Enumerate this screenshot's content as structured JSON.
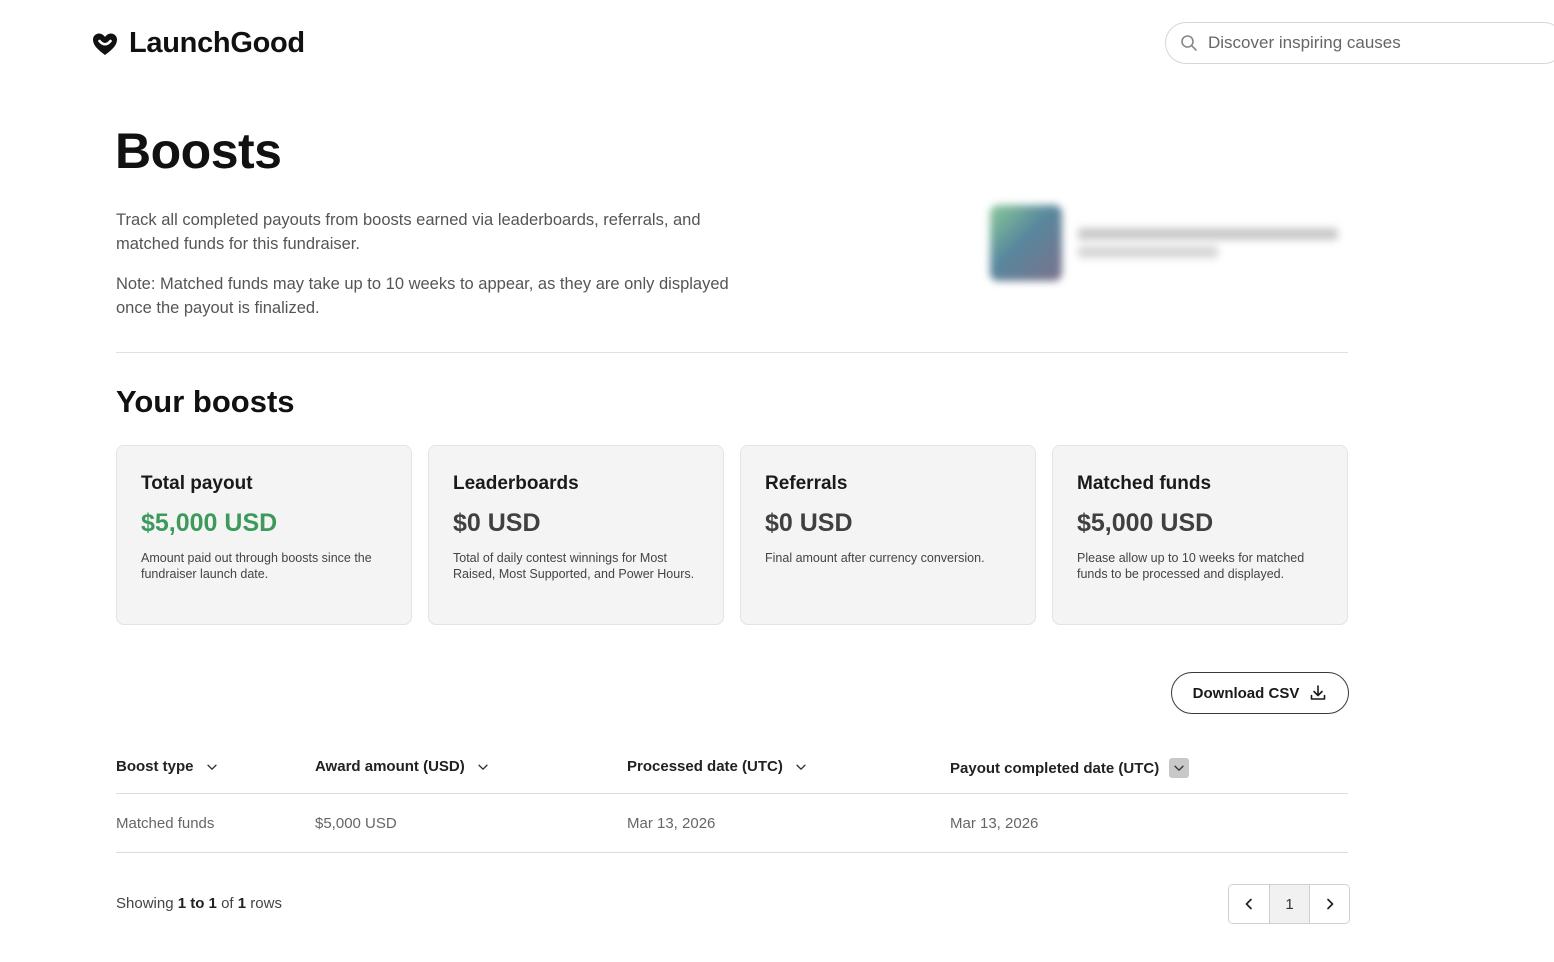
{
  "header": {
    "brand": "LaunchGood",
    "search_placeholder": "Discover inspiring causes"
  },
  "page": {
    "title": "Boosts",
    "intro": "Track all completed payouts from boosts earned via leaderboards, referrals, and matched funds for this fundraiser.",
    "note": "Note: Matched funds may take up to 10 weeks to appear, as they are only displayed once the payout is finalized."
  },
  "boosts": {
    "section_title": "Your boosts",
    "cards": [
      {
        "title": "Total payout",
        "value": "$5,000 USD",
        "desc": "Amount paid out through boosts since the fundraiser launch date."
      },
      {
        "title": "Leaderboards",
        "value": "$0 USD",
        "desc": "Total of daily contest winnings for Most Raised, Most Supported, and Power Hours."
      },
      {
        "title": "Referrals",
        "value": "$0 USD",
        "desc": "Final amount after currency conversion."
      },
      {
        "title": "Matched funds",
        "value": "$5,000 USD",
        "desc": "Please allow up to 10 weeks for matched funds to be processed and displayed."
      }
    ],
    "accent_color": "#3e9a5c"
  },
  "download_label": "Download CSV",
  "table": {
    "headers": [
      "Boost type",
      "Award amount (USD)",
      "Processed date (UTC)",
      "Payout completed date (UTC)"
    ],
    "rows": [
      [
        "Matched funds",
        "$5,000 USD",
        "Mar 13, 2026",
        "Mar 13, 2026"
      ]
    ]
  },
  "pagination": {
    "prefix": "Showing ",
    "range": "1 to 1",
    "of": " of ",
    "total": "1",
    "suffix": " rows",
    "current_page": "1"
  }
}
